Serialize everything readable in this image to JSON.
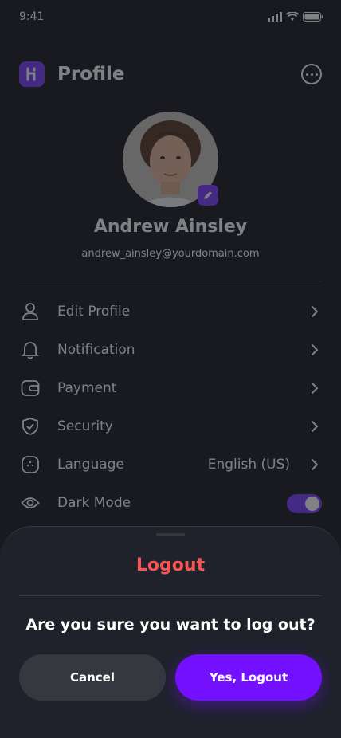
{
  "status_bar": {
    "time": "9:41"
  },
  "header": {
    "title": "Profile"
  },
  "profile": {
    "name": "Andrew Ainsley",
    "email": "andrew_ainsley@yourdomain.com"
  },
  "menu": {
    "items": [
      {
        "label": "Edit Profile",
        "icon": "user-icon"
      },
      {
        "label": "Notification",
        "icon": "bell-icon"
      },
      {
        "label": "Payment",
        "icon": "wallet-icon"
      },
      {
        "label": "Security",
        "icon": "shield-icon"
      },
      {
        "label": "Language",
        "icon": "chat-icon",
        "value": "English (US)"
      },
      {
        "label": "Dark Mode",
        "icon": "eye-icon",
        "toggle": true
      }
    ]
  },
  "logout_sheet": {
    "title": "Logout",
    "message": "Are you sure you want to log out?",
    "cancel_label": "Cancel",
    "confirm_label": "Yes, Logout"
  },
  "colors": {
    "background": "#181a20",
    "sheet": "#1f222a",
    "accent": "#7210ff",
    "danger": "#f75555",
    "secondary_button": "#35383f"
  }
}
